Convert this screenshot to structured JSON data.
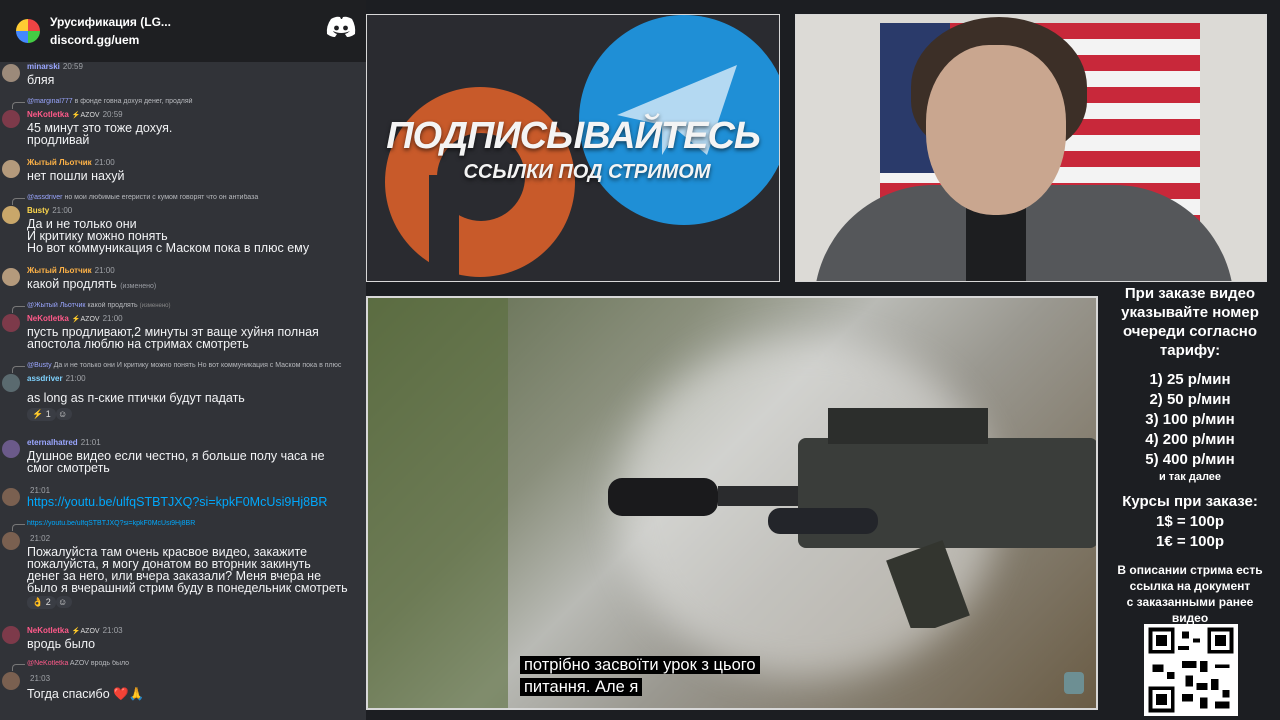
{
  "chat": {
    "server_name": "Урусификация (LG...",
    "server_invite": "discord.gg/uem",
    "messages": [
      {
        "author": "minarski",
        "author_color": "#9aa6ff",
        "badges": "",
        "time": "20:59",
        "reply": "",
        "body": "бляя"
      },
      {
        "author": "NeKotletka",
        "author_color": "#ff5a8a",
        "badges": "⚡AZOV",
        "time": "20:59",
        "reply_name": "@marginal777",
        "reply": "в фонде говна дохуя денег, продляй",
        "body": "45 минут это тоже дохуя.\nпродливай"
      },
      {
        "author": "Жытый Льотчик",
        "author_color": "#ffb347",
        "badges": "",
        "time": "21:00",
        "reply": "",
        "body": "нет пошли нахуй"
      },
      {
        "author": "Busty",
        "author_color": "#ffd84d",
        "badges": "",
        "time": "21:00",
        "reply_name": "@assdriver",
        "reply": "но мои любимые егеристи с кумом говорят что он антибаза",
        "body": "Да и не только они\nИ критику можно понять\nНо вот коммуникация с Маском пока в плюс ему"
      },
      {
        "author": "Жытый Льотчик",
        "author_color": "#ffb347",
        "badges": "",
        "time": "21:00",
        "reply": "",
        "body": "какой продлять",
        "edited": "(изменено)"
      },
      {
        "author": "NeKotletka",
        "author_color": "#ff5a8a",
        "badges": "⚡AZOV",
        "time": "21:00",
        "reply_name": "@Жытый Льотчик",
        "reply": "какой продлять",
        "reply_edited": "(изменено)",
        "body": "пусть продливают,2 минуты эт ваще хуйня полная\nапостола люблю на стримах смотреть"
      },
      {
        "author": "assdriver",
        "author_color": "#7fd3ff",
        "badges": "",
        "time": "21:00",
        "reply_name": "@Busty",
        "reply": "Да и не только они И критику можно понять Но вот коммуникация с Маском пока в плюс",
        "body": "as long as п-ские птички будут падать",
        "react": "1"
      },
      {
        "author": "eternalhatred",
        "author_color": "#9aa6ff",
        "badges": "",
        "time": "21:01",
        "reply": "",
        "body": "Душное видео если честно, я больше полу часа не\nсмог смотреть"
      },
      {
        "author": "",
        "author_color": "#9aa6ff",
        "badges": "",
        "time": "21:01",
        "reply": "",
        "body_link": "https://youtu.be/ulfqSTBTJXQ?si=kpkF0McUsi9Hj8BR"
      },
      {
        "author": "",
        "author_color": "#9aa6ff",
        "badges": "",
        "time": "21:02",
        "reply_name": "",
        "reply": "https://youtu.be/ulfqSTBTJXQ?si=kpkF0McUsi9Hj8BR",
        "body": "Пожалуйста там очень красвое видео, закажите\nпожалуйста, я могу донатом во вторник закинуть\nденег за него, или вчера заказали? Меня вчера не\nбыло я вчерашний стрим буду в понедельник смотреть",
        "react": "2"
      },
      {
        "author": "NeKotletka",
        "author_color": "#ff5a8a",
        "badges": "⚡AZOV",
        "time": "21:03",
        "reply": "",
        "body": "вродь было"
      },
      {
        "author": "",
        "author_color": "#9aa6ff",
        "badges": "",
        "time": "21:03",
        "reply_name": "@NeKotletka",
        "reply": "AZOV вродь было",
        "body": "Тогда спасибо ❤️🙏"
      }
    ]
  },
  "banner": {
    "title": "ПОДПИСЫВАЙТЕСЬ",
    "subtitle": "ССЫЛКИ ПОД СТРИМОМ"
  },
  "video": {
    "subtitle_line1": "потрібно засвоїти урок з цього",
    "subtitle_line2": "питання.  Але я"
  },
  "info": {
    "intro": [
      "При заказе видео",
      "указывайте номер",
      "очереди согласно",
      "тарифу:"
    ],
    "tariffs": [
      "1) 25 р/мин",
      "2) 50 р/мин",
      "3) 100 р/мин",
      "4) 200 р/мин",
      "5) 400 р/мин"
    ],
    "etc": "и так далее",
    "courses_title": "Курсы при заказе:",
    "courses": [
      "1$ = 100р",
      "1€ = 100р"
    ],
    "outro": [
      "В описании стрима есть",
      "ссылка на документ",
      "с заказанными ранее",
      "видео"
    ]
  },
  "colors": {
    "discord_bg": "#313338",
    "link": "#00a8fc",
    "banner_orange": "#c85a2a",
    "banner_blue": "#1f8fd6"
  }
}
